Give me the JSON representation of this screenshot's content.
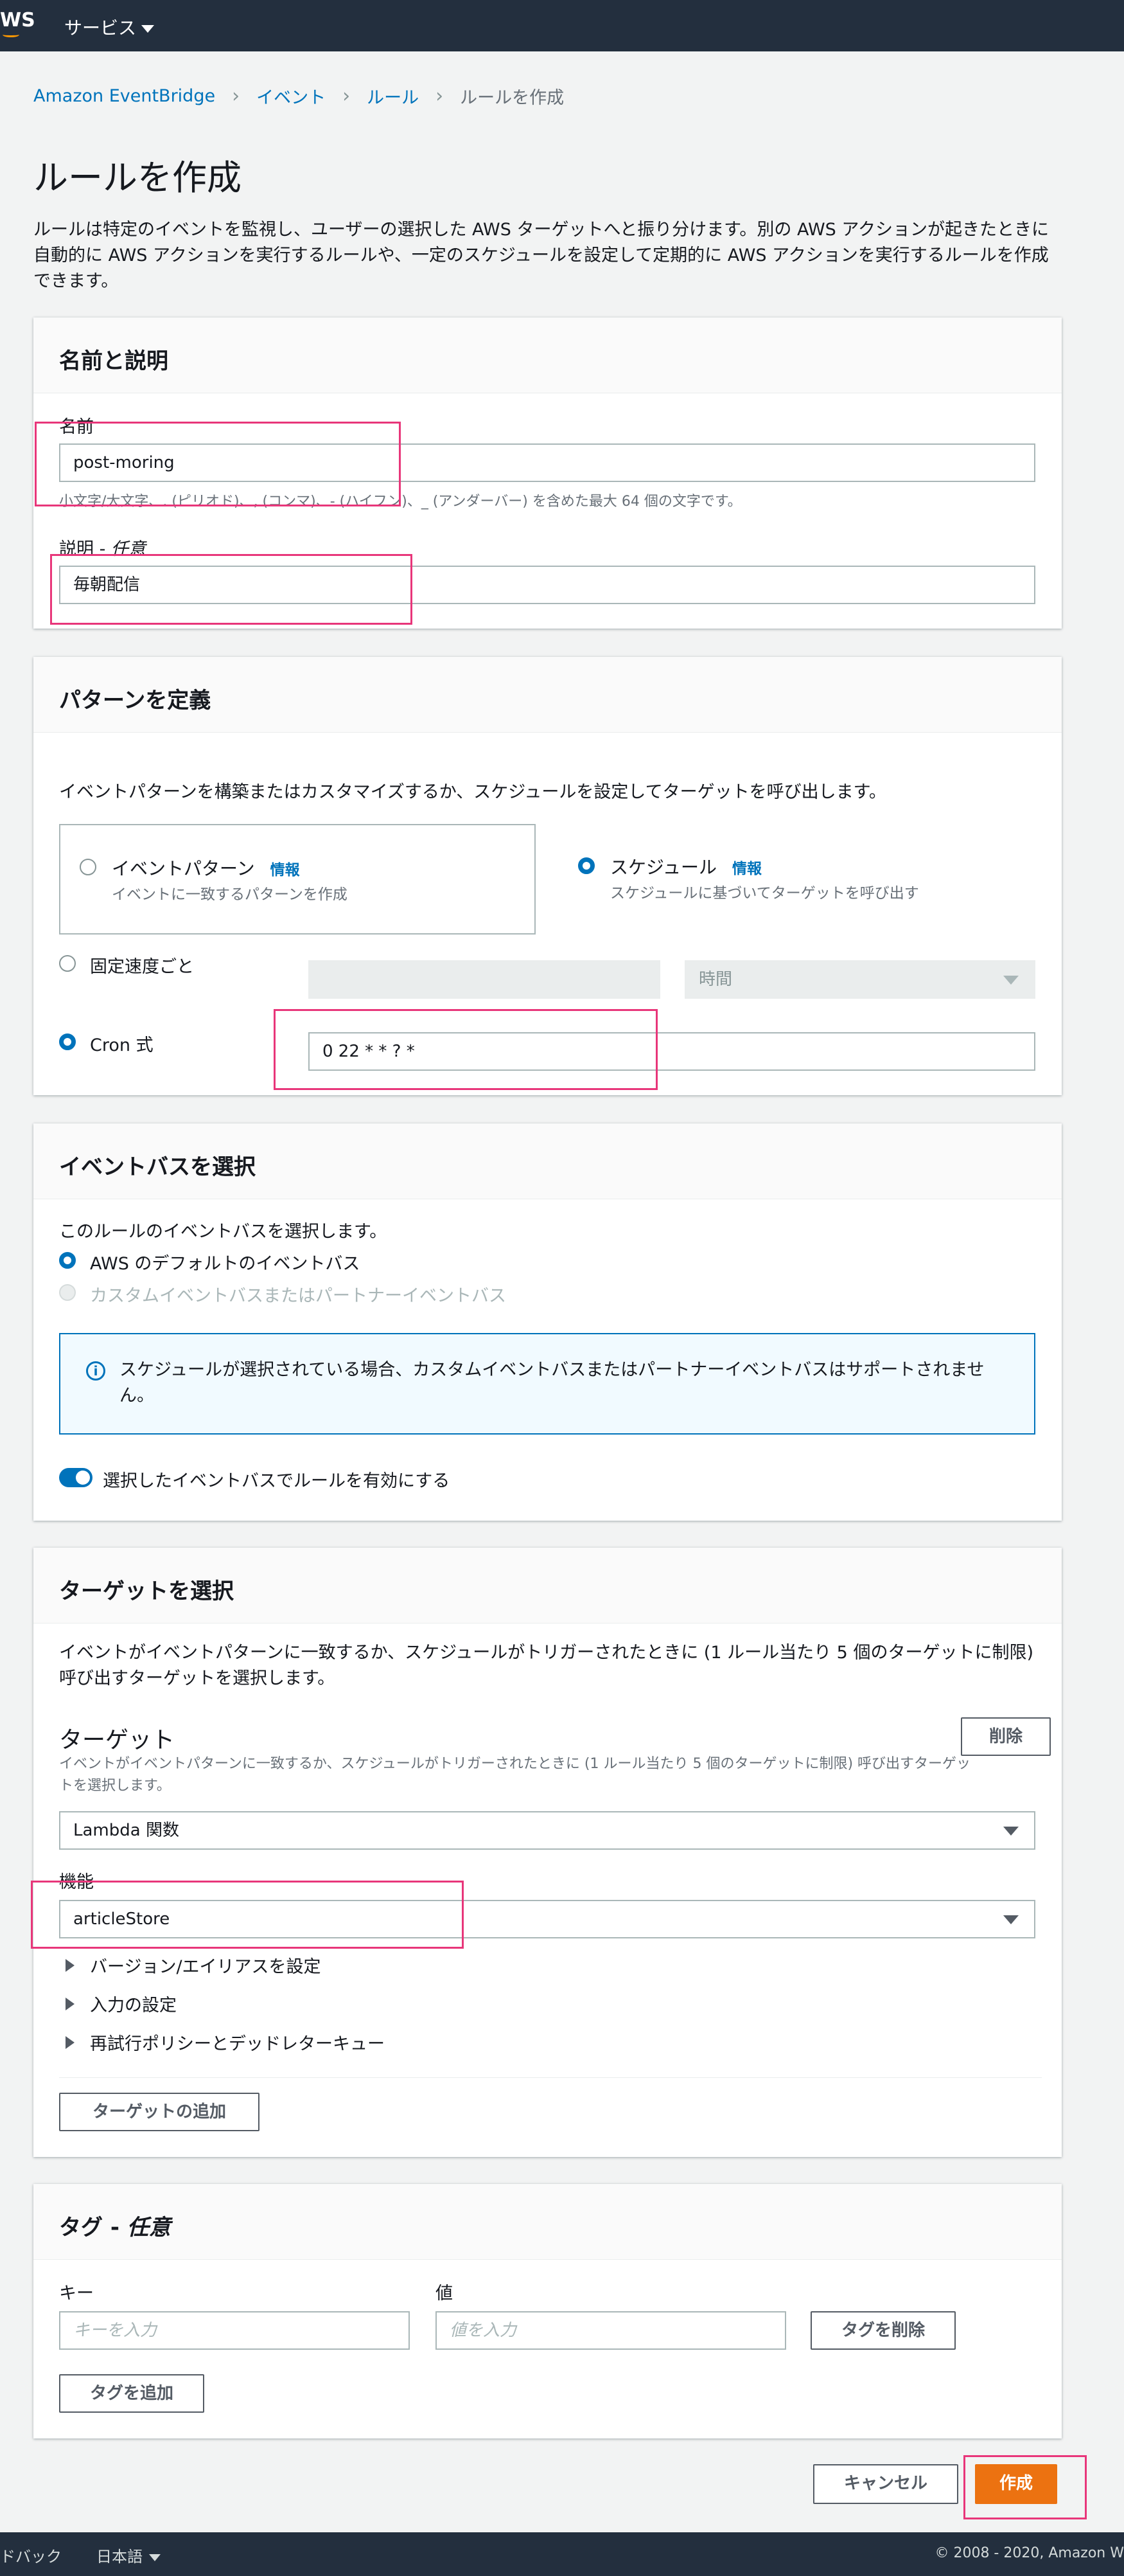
{
  "topbar": {
    "logo": "WS",
    "services_label": "サービス"
  },
  "breadcrumb": {
    "items": [
      "Amazon EventBridge",
      "イベント",
      "ルール"
    ],
    "current": "ルールを作成"
  },
  "page": {
    "title": "ルールを作成",
    "description": "ルールは特定のイベントを監視し、ユーザーの選択した AWS ターゲットへと振り分けます。別の AWS アクションが起きたときに自動的に AWS アクションを実行するルールや、一定のスケジュールを設定して定期的に AWS アクションを実行するルールを作成できます。"
  },
  "name_section": {
    "title": "名前と説明",
    "name_label": "名前",
    "name_value": "post-moring",
    "name_hint": "小文字/大文字、. (ピリオド)、, (コンマ)、- (ハイフン)、_ (アンダーバー) を含めた最大 64 個の文字です。",
    "desc_label": "説明 - 任意",
    "desc_value": "毎朝配信"
  },
  "pattern_section": {
    "title": "パターンを定義",
    "description": "イベントパターンを構築またはカスタマイズするか、スケジュールを設定してターゲットを呼び出します。",
    "event_pattern_title": "イベントパターン",
    "event_pattern_info": "情報",
    "event_pattern_sub": "イベントに一致するパターンを作成",
    "schedule_title": "スケジュール",
    "schedule_info": "情報",
    "schedule_sub": "スケジュールに基づいてターゲットを呼び出す",
    "fixed_rate_label": "固定速度ごと",
    "time_unit": "時間",
    "cron_label": "Cron 式",
    "cron_value": "0 22 * * ? *"
  },
  "eventbus_section": {
    "title": "イベントバスを選択",
    "description": "このルールのイベントバスを選択します。",
    "default_bus": "AWS のデフォルトのイベントバス",
    "custom_bus": "カスタムイベントバスまたはパートナーイベントバス",
    "info_text": "スケジュールが選択されている場合、カスタムイベントバスまたはパートナーイベントバスはサポートされません。",
    "toggle_label": "選択したイベントバスでルールを有効にする"
  },
  "target_section": {
    "title": "ターゲットを選択",
    "description": "イベントがイベントパターンに一致するか、スケジュールがトリガーされたときに (1 ルール当たり 5 個のターゲットに制限) 呼び出すターゲットを選択します。",
    "target_heading": "ターゲット",
    "target_sub": "イベントがイベントパターンに一致するか、スケジュールがトリガーされたときに (1 ルール当たり 5 個のターゲットに制限) 呼び出すターゲットを選択します。",
    "remove_button": "削除",
    "target_type": "Lambda 関数",
    "function_label": "機能",
    "function_value": "articleStore",
    "expanders": [
      "バージョン/エイリアスを設定",
      "入力の設定",
      "再試行ポリシーとデッドレターキュー"
    ],
    "add_target_button": "ターゲットの追加"
  },
  "tags_section": {
    "title_prefix": "タグ - ",
    "title_suffix": "任意",
    "key_label": "キー",
    "value_label": "値",
    "key_placeholder": "キーを入力",
    "value_placeholder": "値を入力",
    "remove_tag_button": "タグを削除",
    "add_tag_button": "タグを追加"
  },
  "actions": {
    "cancel": "キャンセル",
    "create": "作成"
  },
  "footer": {
    "feedback": "ドバック",
    "language": "日本語",
    "copyright": "© 2008 - 2020, Amazon W"
  }
}
